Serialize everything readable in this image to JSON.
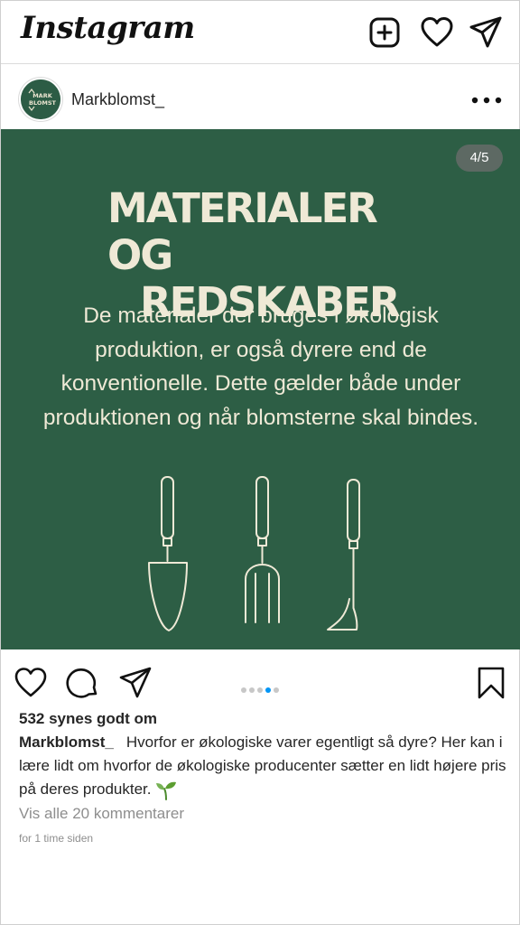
{
  "app": {
    "logo_text": "Instagram"
  },
  "top_icons": [
    "new-post-icon",
    "heart-icon",
    "direct-message-icon"
  ],
  "post": {
    "username": "Markblomst_",
    "avatar_text_line1": "MARK",
    "avatar_text_line2": "BLOMST",
    "carousel_counter": "4/5",
    "carousel_total": 5,
    "carousel_active_index": 4,
    "image": {
      "title_line1": "MATERIALER OG",
      "title_line2": "REDSKABER",
      "body": "De materialer der bruges i økologisk produktion, er også dyrere end de konventionelle. Dette gælder både under produktionen og når blomsterne skal bindes.",
      "background_color": "#2d5e45",
      "text_color": "#efe9d6"
    },
    "likes": "532 synes godt om",
    "caption_user": "Markblomst_",
    "caption_text": "Hvorfor er økologiske varer egentligt så dyre? Her kan i lære lidt om hvorfor de økologiske producenter sætter en lidt højere pris på deres produkter.",
    "view_comments": "Vis alle 20 kommentarer",
    "timestamp": "for 1 time siden"
  },
  "colors": {
    "accent": "#0095f6",
    "muted_text": "#8e8e8e"
  }
}
